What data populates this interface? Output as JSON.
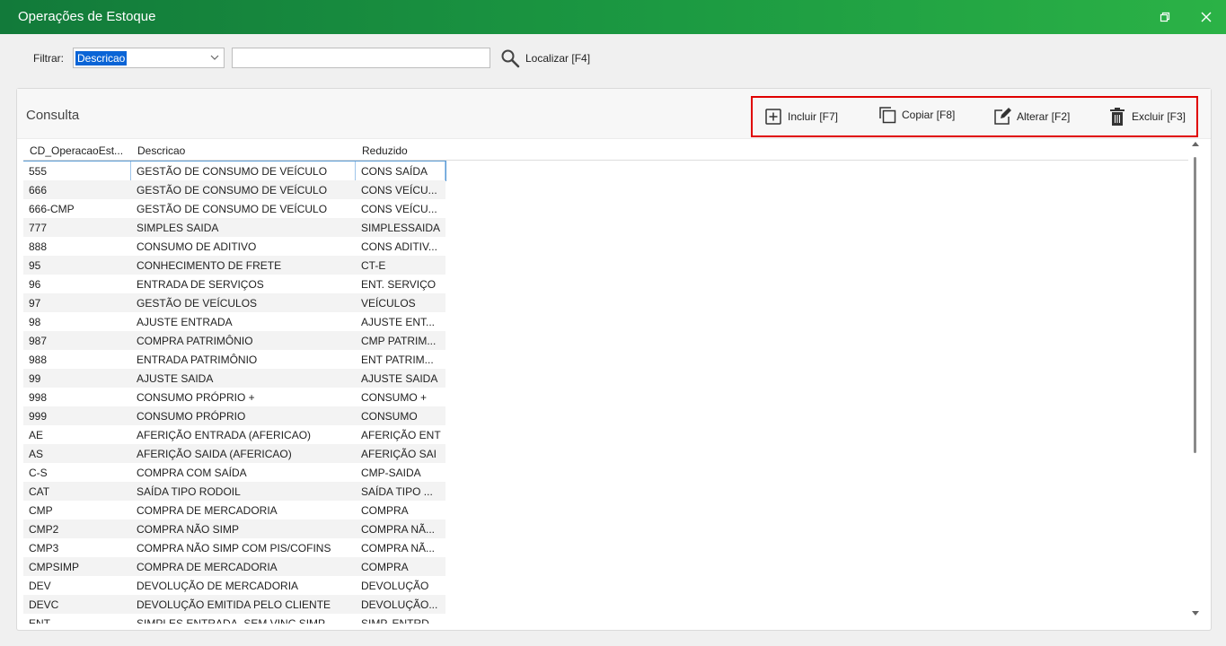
{
  "window": {
    "title": "Operações de Estoque"
  },
  "filter": {
    "label": "Filtrar:",
    "field_value": "Descricao",
    "search_value": "",
    "locate_label": "Localizar [F4]"
  },
  "panel": {
    "title": "Consulta"
  },
  "toolbar": {
    "include_label": "Incluir [F7]",
    "copy_label": "Copiar [F8]",
    "edit_label": "Alterar [F2]",
    "delete_label": "Excluir [F3]"
  },
  "grid": {
    "columns": [
      "CD_OperacaoEst...",
      "Descricao",
      "Reduzido"
    ],
    "rows": [
      [
        "555",
        "GESTÃO DE CONSUMO DE VEÍCULO",
        "CONS SAÍDA"
      ],
      [
        "666",
        "GESTÃO DE CONSUMO DE VEÍCULO",
        "CONS VEÍCU..."
      ],
      [
        "666-CMP",
        "GESTÃO DE CONSUMO DE VEÍCULO",
        "CONS VEÍCU..."
      ],
      [
        "777",
        "SIMPLES SAIDA",
        "SIMPLESSAIDA"
      ],
      [
        "888",
        "CONSUMO DE ADITIVO",
        "CONS ADITIV..."
      ],
      [
        "95",
        "CONHECIMENTO DE FRETE",
        "CT-E"
      ],
      [
        "96",
        "ENTRADA DE SERVIÇOS",
        "ENT. SERVIÇO"
      ],
      [
        "97",
        "GESTÃO DE VEÍCULOS",
        "VEÍCULOS"
      ],
      [
        "98",
        "AJUSTE ENTRADA",
        "AJUSTE ENT..."
      ],
      [
        "987",
        "COMPRA PATRIMÔNIO",
        "CMP PATRIM..."
      ],
      [
        "988",
        "ENTRADA PATRIMÔNIO",
        "ENT PATRIM..."
      ],
      [
        "99",
        "AJUSTE SAIDA",
        "AJUSTE SAIDA"
      ],
      [
        "998",
        "CONSUMO PRÓPRIO +",
        "CONSUMO +"
      ],
      [
        "999",
        "CONSUMO PRÓPRIO",
        "CONSUMO"
      ],
      [
        "AE",
        "AFERIÇÃO ENTRADA (AFERICAO)",
        "AFERIÇÃO ENT"
      ],
      [
        "AS",
        "AFERIÇÃO SAIDA (AFERICAO)",
        "AFERIÇÃO SAI"
      ],
      [
        "C-S",
        "COMPRA COM SAÍDA",
        "CMP-SAIDA"
      ],
      [
        "CAT",
        "SAÍDA TIPO RODOIL",
        "SAÍDA TIPO ..."
      ],
      [
        "CMP",
        "COMPRA DE MERCADORIA",
        "COMPRA"
      ],
      [
        "CMP2",
        "COMPRA NÃO SIMP",
        "COMPRA NÃ..."
      ],
      [
        "CMP3",
        "COMPRA NÃO SIMP COM PIS/COFINS",
        "COMPRA NÃ..."
      ],
      [
        "CMPSIMP",
        "COMPRA DE MERCADORIA",
        "COMPRA"
      ],
      [
        "DEV",
        "DEVOLUÇÃO DE MERCADORIA",
        "DEVOLUÇÃO"
      ],
      [
        "DEVC",
        "DEVOLUÇÃO EMITIDA PELO CLIENTE",
        "DEVOLUÇÃO..."
      ],
      [
        "ENT",
        "SIMPLES ENTRADA -SEM VINC SIMP",
        "SIMP. ENTRD..."
      ]
    ]
  },
  "colors": {
    "title_gradient_start": "#127a3a",
    "title_gradient_end": "#2bb246",
    "highlight_border": "#e00000",
    "selection": "#0a64d6"
  }
}
